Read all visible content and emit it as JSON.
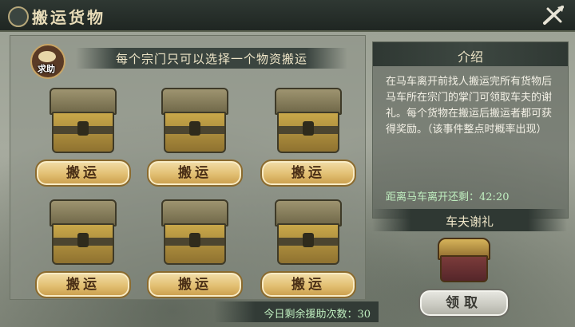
{
  "window": {
    "title": "搬运货物"
  },
  "help": {
    "label": "求助"
  },
  "main": {
    "banner": "每个宗门只可以选择一个物资搬运",
    "chests": [
      {
        "button_label": "搬运"
      },
      {
        "button_label": "搬运"
      },
      {
        "button_label": "搬运"
      },
      {
        "button_label": "搬运"
      },
      {
        "button_label": "搬运"
      },
      {
        "button_label": "搬运"
      }
    ],
    "remaining_label": "今日剩余援助次数：",
    "remaining_count": "30"
  },
  "info": {
    "title": "介绍",
    "text": "在马车离开前找人搬运完所有货物后马车所在宗门的掌门可领取车夫的谢礼。每个货物在搬运后搬运者都可获得奖励。（该事件整点时概率出现）",
    "countdown_label": "距离马车离开还剩：",
    "countdown_value": "42:20"
  },
  "reward": {
    "title": "车夫谢礼",
    "claim_label": "领取"
  },
  "colors": {
    "title_bar": "#2f3833",
    "gold_button": "#e2bf72",
    "grey_button": "#c9c9c0",
    "countdown_text": "#bfeebf"
  },
  "icons": {
    "close": "close-icon",
    "help": "help-icon",
    "chest": "chest-icon",
    "reward": "treasure-chest-icon"
  }
}
